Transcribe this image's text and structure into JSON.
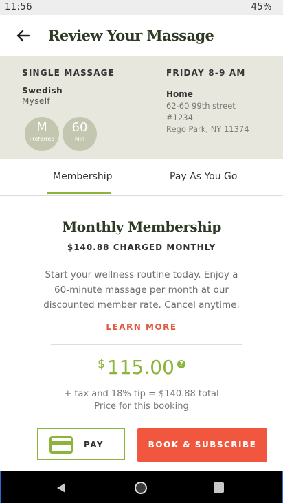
{
  "status_bar": {
    "time": "11:56",
    "battery": "45%"
  },
  "header": {
    "title": "Review Your Massage",
    "back_icon": "arrow-left-icon"
  },
  "summary": {
    "type_label": "SINGLE MASSAGE",
    "service": "Swedish",
    "recipient": "Myself",
    "badges": [
      {
        "big": "M",
        "small": "Preferred"
      },
      {
        "big": "60",
        "small": "Min"
      }
    ],
    "time_label": "FRIDAY 8-9 AM",
    "location_name": "Home",
    "address_line1": "62-60 99th street",
    "address_line2": "#1234",
    "address_line3": "Rego Park, NY 11374"
  },
  "tabs": [
    {
      "label": "Membership",
      "active": true
    },
    {
      "label": "Pay As You Go",
      "active": false
    }
  ],
  "membership": {
    "title": "Monthly Membership",
    "subtitle": "$140.88 CHARGED MONTHLY",
    "description": "Start your wellness routine today. Enjoy a 60-minute massage per month at our discounted member rate. Cancel anytime.",
    "learn_more": "LEARN MORE",
    "price_symbol": "$",
    "price_value": "115.00",
    "help_icon": "question-icon",
    "price_note1": "+ tax and 18% tip = $140.88 total",
    "price_note2": "Price for this booking"
  },
  "actions": {
    "pay_label": "PAY",
    "pay_icon": "credit-card-icon",
    "subscribe_label": "BOOK & SUBSCRIBE"
  },
  "colors": {
    "accent_green": "#8cb33c",
    "cta_orange": "#f0573e",
    "title_dark": "#2f3a25",
    "summary_bg": "#e7e7de"
  }
}
